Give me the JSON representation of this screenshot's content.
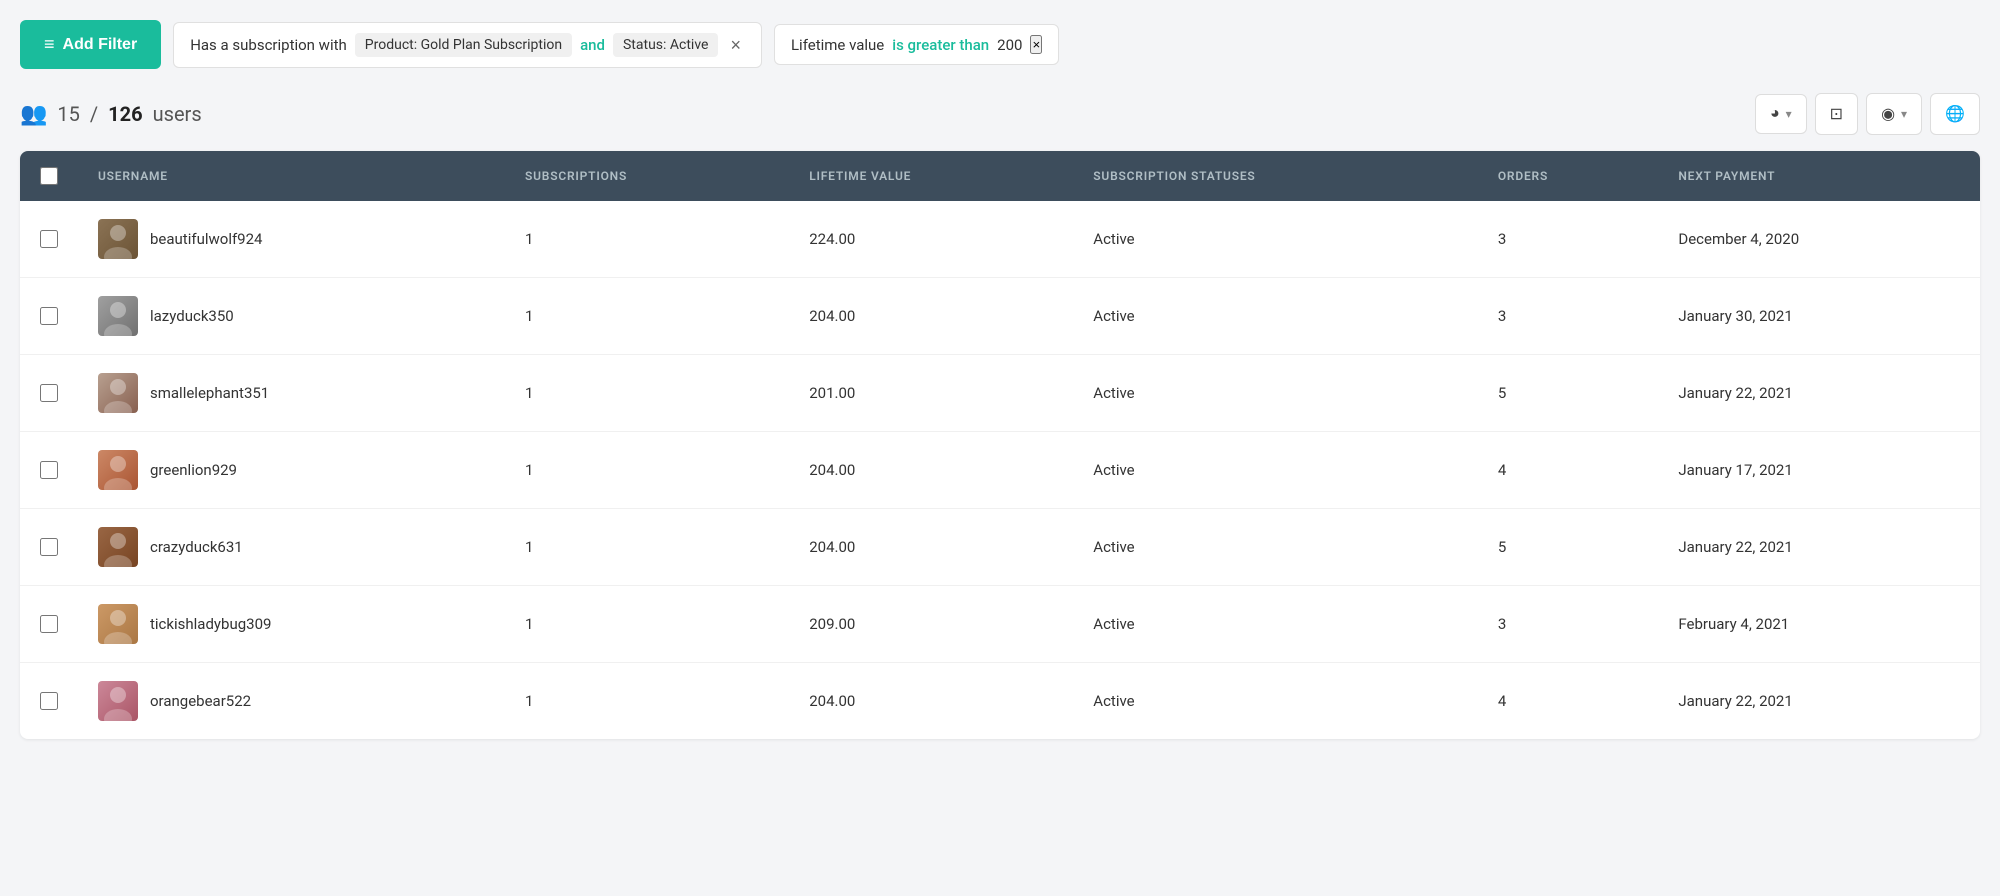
{
  "filters": {
    "add_filter_label": "Add Filter",
    "filter1": {
      "prefix": "Has a subscription with",
      "tag1": "Product: Gold Plan Subscription",
      "connector": "and",
      "tag2": "Status: Active"
    },
    "filter2": {
      "prefix": "Lifetime value",
      "operator": "is greater than",
      "value": "200"
    }
  },
  "stats": {
    "filtered_count": "15",
    "separator": "/",
    "total_count": "126",
    "label": "users"
  },
  "table": {
    "columns": [
      "",
      "USERNAME",
      "SUBSCRIPTIONS",
      "LIFETIME VALUE",
      "SUBSCRIPTION STATUSES",
      "ORDERS",
      "NEXT PAYMENT"
    ],
    "rows": [
      {
        "username": "beautifulwolf924",
        "subscriptions": "1",
        "lifetime_value": "224.00",
        "status": "Active",
        "orders": "3",
        "next_payment": "December 4, 2020",
        "avatar_class": "avatar-1"
      },
      {
        "username": "lazyduck350",
        "subscriptions": "1",
        "lifetime_value": "204.00",
        "status": "Active",
        "orders": "3",
        "next_payment": "January 30, 2021",
        "avatar_class": "avatar-2"
      },
      {
        "username": "smallelephant351",
        "subscriptions": "1",
        "lifetime_value": "201.00",
        "status": "Active",
        "orders": "5",
        "next_payment": "January 22, 2021",
        "avatar_class": "avatar-3"
      },
      {
        "username": "greenlion929",
        "subscriptions": "1",
        "lifetime_value": "204.00",
        "status": "Active",
        "orders": "4",
        "next_payment": "January 17, 2021",
        "avatar_class": "avatar-4"
      },
      {
        "username": "crazyduck631",
        "subscriptions": "1",
        "lifetime_value": "204.00",
        "status": "Active",
        "orders": "5",
        "next_payment": "January 22, 2021",
        "avatar_class": "avatar-5"
      },
      {
        "username": "tickishladybug309",
        "subscriptions": "1",
        "lifetime_value": "209.00",
        "status": "Active",
        "orders": "3",
        "next_payment": "February 4, 2021",
        "avatar_class": "avatar-6"
      },
      {
        "username": "orangebear522",
        "subscriptions": "1",
        "lifetime_value": "204.00",
        "status": "Active",
        "orders": "4",
        "next_payment": "January 22, 2021",
        "avatar_class": "avatar-7"
      }
    ]
  },
  "toolbar": {
    "pie_chart_icon": "◕",
    "save_icon": "⊡",
    "eye_icon": "◉",
    "globe_icon": "🌐"
  }
}
